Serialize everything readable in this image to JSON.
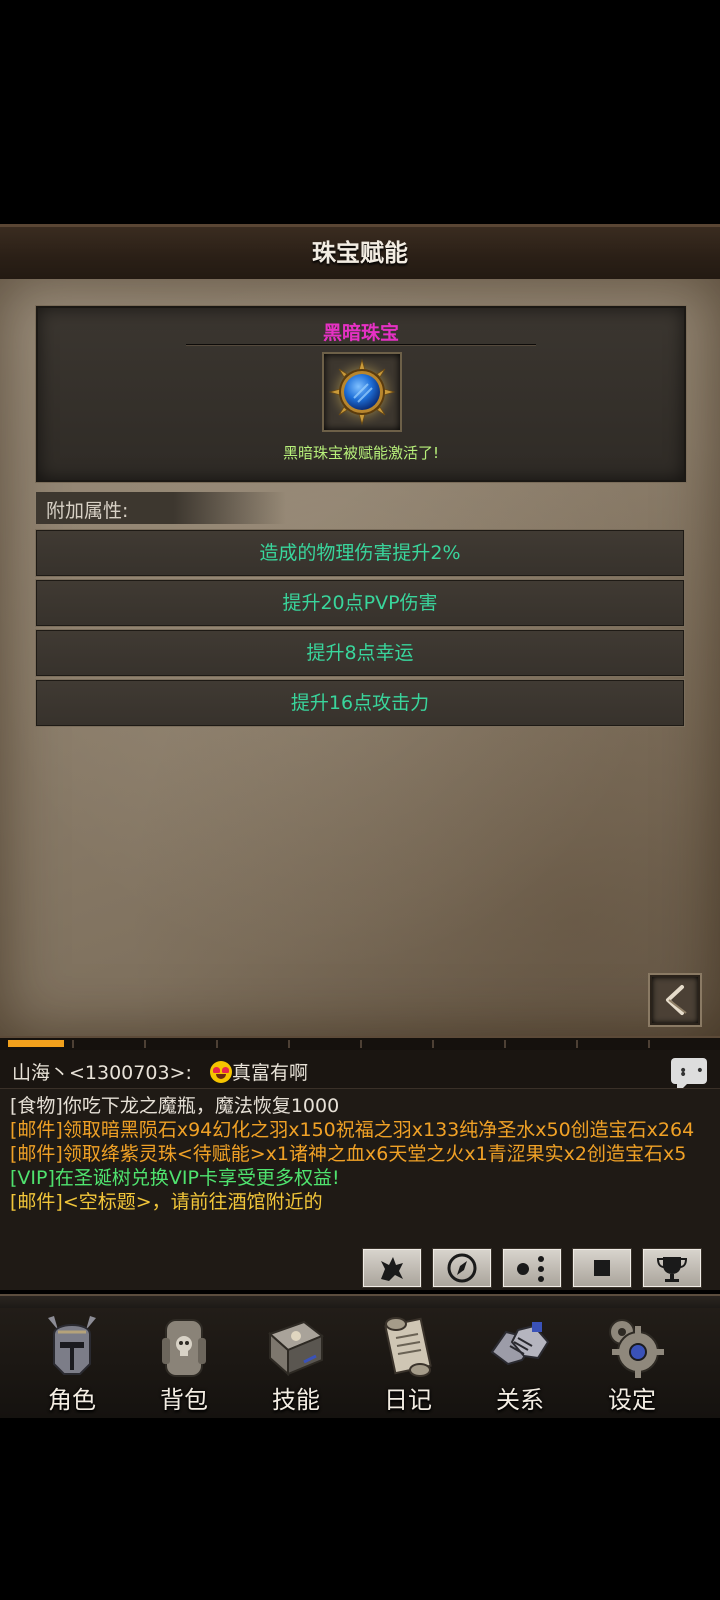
{
  "header": {
    "title": "珠宝赋能"
  },
  "jewel": {
    "name": "黑暗珠宝",
    "status": "黑暗珠宝被赋能激活了!"
  },
  "attributes": {
    "header": "附加属性:",
    "items": [
      "造成的物理伤害提升2%",
      "提升20点PVP伤害",
      "提升8点幸运",
      "提升16点攻击力"
    ]
  },
  "chat": {
    "speaker": "山海丶<1300703>:",
    "speaker_message": "真富有啊",
    "lines": [
      {
        "text": "[食物]你吃下龙之魔瓶，魔法恢复1000",
        "color": "#e6e0d6"
      },
      {
        "text": "[邮件]领取暗黑陨石x94幻化之羽x150祝福之羽x133纯净圣水x50创造宝石x264",
        "color": "#f0a126"
      },
      {
        "text": "[邮件]领取绛紫灵珠<待赋能>x1诸神之血x6天堂之火x1青涩果实x2创造宝石x5",
        "color": "#f0a126"
      },
      {
        "text": "[VIP]在圣诞树兑换VIP卡享受更多权益!",
        "color": "#4fe36e"
      },
      {
        "text": "[邮件]<空标题>，请前往酒馆附近的",
        "color": "#f2c63a"
      }
    ]
  },
  "nav": {
    "items": [
      {
        "label": "角色",
        "icon": "helmet-icon"
      },
      {
        "label": "背包",
        "icon": "backpack-icon"
      },
      {
        "label": "技能",
        "icon": "skill-book-icon"
      },
      {
        "label": "日记",
        "icon": "scroll-icon"
      },
      {
        "label": "关系",
        "icon": "handshake-icon"
      },
      {
        "label": "设定",
        "icon": "gear-icon"
      }
    ]
  },
  "colors": {
    "jewel_name": "#e631c4",
    "jewel_status": "#b7f07a",
    "attribute_text": "#39d59c",
    "progress": "#f0a01c"
  }
}
